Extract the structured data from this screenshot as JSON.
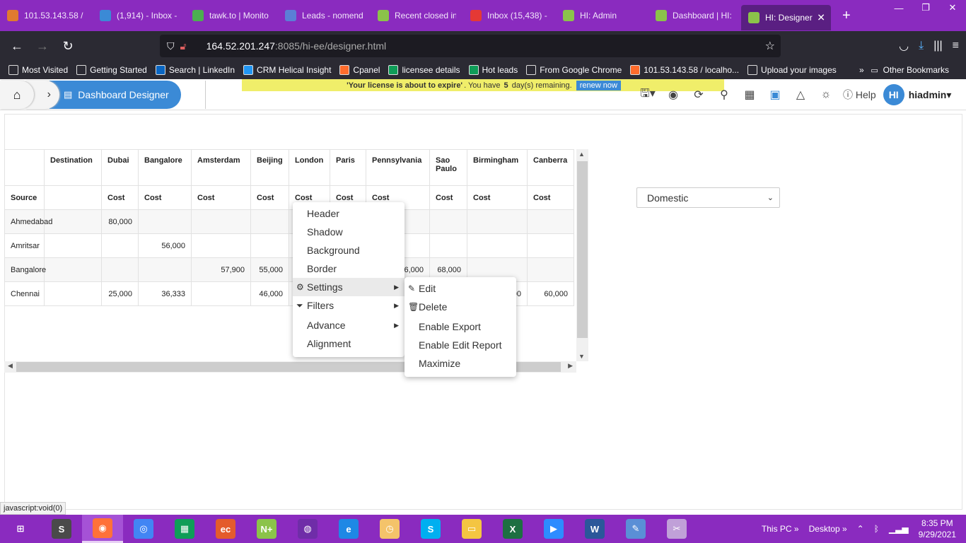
{
  "browser": {
    "tabs": [
      {
        "label": "101.53.143.58 / l",
        "icon": "database-icon",
        "color": "#e07a2f"
      },
      {
        "label": "(1,914) - Inbox -",
        "icon": "mail-icon",
        "color": "#3b8ad6"
      },
      {
        "label": "tawk.to | Monito",
        "icon": "tawk-icon",
        "color": "#4caf50"
      },
      {
        "label": "Leads - nomend",
        "icon": "globe-icon",
        "color": "#5b7fd6"
      },
      {
        "label": "Recent closed in",
        "icon": "helical-icon",
        "color": "#8bc34a"
      },
      {
        "label": "Inbox (15,438) -",
        "icon": "gmail-icon",
        "color": "#e53935"
      },
      {
        "label": "HI: Admin",
        "icon": "helical-icon",
        "color": "#8bc34a"
      },
      {
        "label": "Dashboard | HI: I",
        "icon": "helical-icon",
        "color": "#8bc34a"
      },
      {
        "label": "HI: Designer",
        "icon": "helical-icon",
        "color": "#8bc34a",
        "active": true
      }
    ],
    "url_host": "164.52.201.247",
    "url_rest": ":8085/hi-ee/designer.html",
    "bookmarks": [
      {
        "label": "Most Visited",
        "icon": "gear-icon",
        "color": "#2b2a33"
      },
      {
        "label": "Getting Started",
        "icon": "globe-icon",
        "color": "#2b2a33"
      },
      {
        "label": "Search | LinkedIn",
        "icon": "linkedin-icon",
        "color": "#0a66c2"
      },
      {
        "label": "CRM Helical Insight",
        "icon": "crm-icon",
        "color": "#2196f3"
      },
      {
        "label": "Cpanel",
        "icon": "cpanel-icon",
        "color": "#ff6c2c"
      },
      {
        "label": "licensee details",
        "icon": "plus-sheet-icon",
        "color": "#0f9d58"
      },
      {
        "label": "Hot leads",
        "icon": "plus-sheet-icon",
        "color": "#0f9d58"
      },
      {
        "label": "From Google Chrome",
        "icon": "folder-icon",
        "color": "#2b2a33"
      },
      {
        "label": "101.53.143.58 / localho...",
        "icon": "cpanel-icon",
        "color": "#ff6c2c"
      },
      {
        "label": "Upload your images",
        "icon": "globe-icon",
        "color": "#2b2a33"
      }
    ],
    "other_bookmarks": "Other Bookmarks",
    "status_text": "javascript:void(0)"
  },
  "app": {
    "crumb_label": "Dashboard Designer",
    "license_pre": "'Your license is about to expire'",
    "license_mid": ". You have",
    "license_days": "5",
    "license_post": "day(s) remaining.",
    "renew_label": "renew now",
    "help_label": "Help",
    "avatar_initials": "HI",
    "username": "hiadmin"
  },
  "table": {
    "header_row1": [
      "",
      "Destination",
      "Dubai",
      "Bangalore",
      "Amsterdam",
      "Beijing",
      "London",
      "Paris",
      "Pennsylvania",
      "Sao Paulo",
      "Birmingham",
      "Canberra"
    ],
    "header_row2": [
      "Source",
      "",
      "Cost",
      "Cost",
      "Cost",
      "Cost",
      "Cost",
      "Cost",
      "Cost",
      "Cost",
      "Cost",
      "Cost"
    ],
    "rows": [
      [
        "Ahmedabad",
        "",
        "80,000",
        "",
        "",
        "",
        "",
        "",
        "",
        "",
        "",
        ""
      ],
      [
        "Amritsar",
        "",
        "",
        "56,000",
        "",
        "",
        "",
        "",
        "",
        "",
        "",
        ""
      ],
      [
        "Bangalore",
        "",
        "",
        "",
        "57,900",
        "55,000",
        "",
        "",
        "66,000",
        "68,000",
        "",
        ""
      ],
      [
        "Chennai",
        "",
        "25,000",
        "36,333",
        "",
        "46,000",
        "",
        "",
        "",
        "",
        "00",
        "60,000"
      ]
    ]
  },
  "filter_dropdown": {
    "selected": "Domestic"
  },
  "context_menu": {
    "items": [
      "Header",
      "Shadow",
      "Background",
      "Border",
      "Settings",
      "Filters",
      "Advance",
      "Alignment"
    ]
  },
  "settings_submenu": {
    "items": [
      "Edit",
      "Delete",
      "Enable Export",
      "Enable Edit Report",
      "Maximize"
    ]
  },
  "taskbar": {
    "apps": [
      {
        "name": "start-icon",
        "label": "⊞",
        "color": "#8a2bbf"
      },
      {
        "name": "sublime-icon",
        "label": "S",
        "color": "#4a4a4a"
      },
      {
        "name": "firefox-icon",
        "label": "◉",
        "color": "#ff7139"
      },
      {
        "name": "chrome-icon",
        "label": "◎",
        "color": "#4285f4"
      },
      {
        "name": "store-icon",
        "label": "▦",
        "color": "#0f9d58"
      },
      {
        "name": "eclipse-icon",
        "label": "ec",
        "color": "#e45b2c"
      },
      {
        "name": "notepad-icon",
        "label": "N+",
        "color": "#8bc34a"
      },
      {
        "name": "podcast-icon",
        "label": "◍",
        "color": "#6f2da8"
      },
      {
        "name": "edge-icon",
        "label": "e",
        "color": "#1e88e5"
      },
      {
        "name": "outlook-icon",
        "label": "◷",
        "color": "#f4c36a"
      },
      {
        "name": "skype-icon",
        "label": "S",
        "color": "#00aff0"
      },
      {
        "name": "explorer-icon",
        "label": "▭",
        "color": "#f4c542"
      },
      {
        "name": "excel-icon",
        "label": "X",
        "color": "#1d6f42"
      },
      {
        "name": "zoom-icon",
        "label": "▶",
        "color": "#2d8cff"
      },
      {
        "name": "word-icon",
        "label": "W",
        "color": "#2b579a"
      },
      {
        "name": "snip-icon",
        "label": "✎",
        "color": "#5a8fd6"
      },
      {
        "name": "paint-icon",
        "label": "✂",
        "color": "#c0a0d8"
      }
    ],
    "tray_this_pc": "This PC",
    "tray_desktop": "Desktop",
    "time": "8:35 PM",
    "date": "9/29/2021"
  }
}
